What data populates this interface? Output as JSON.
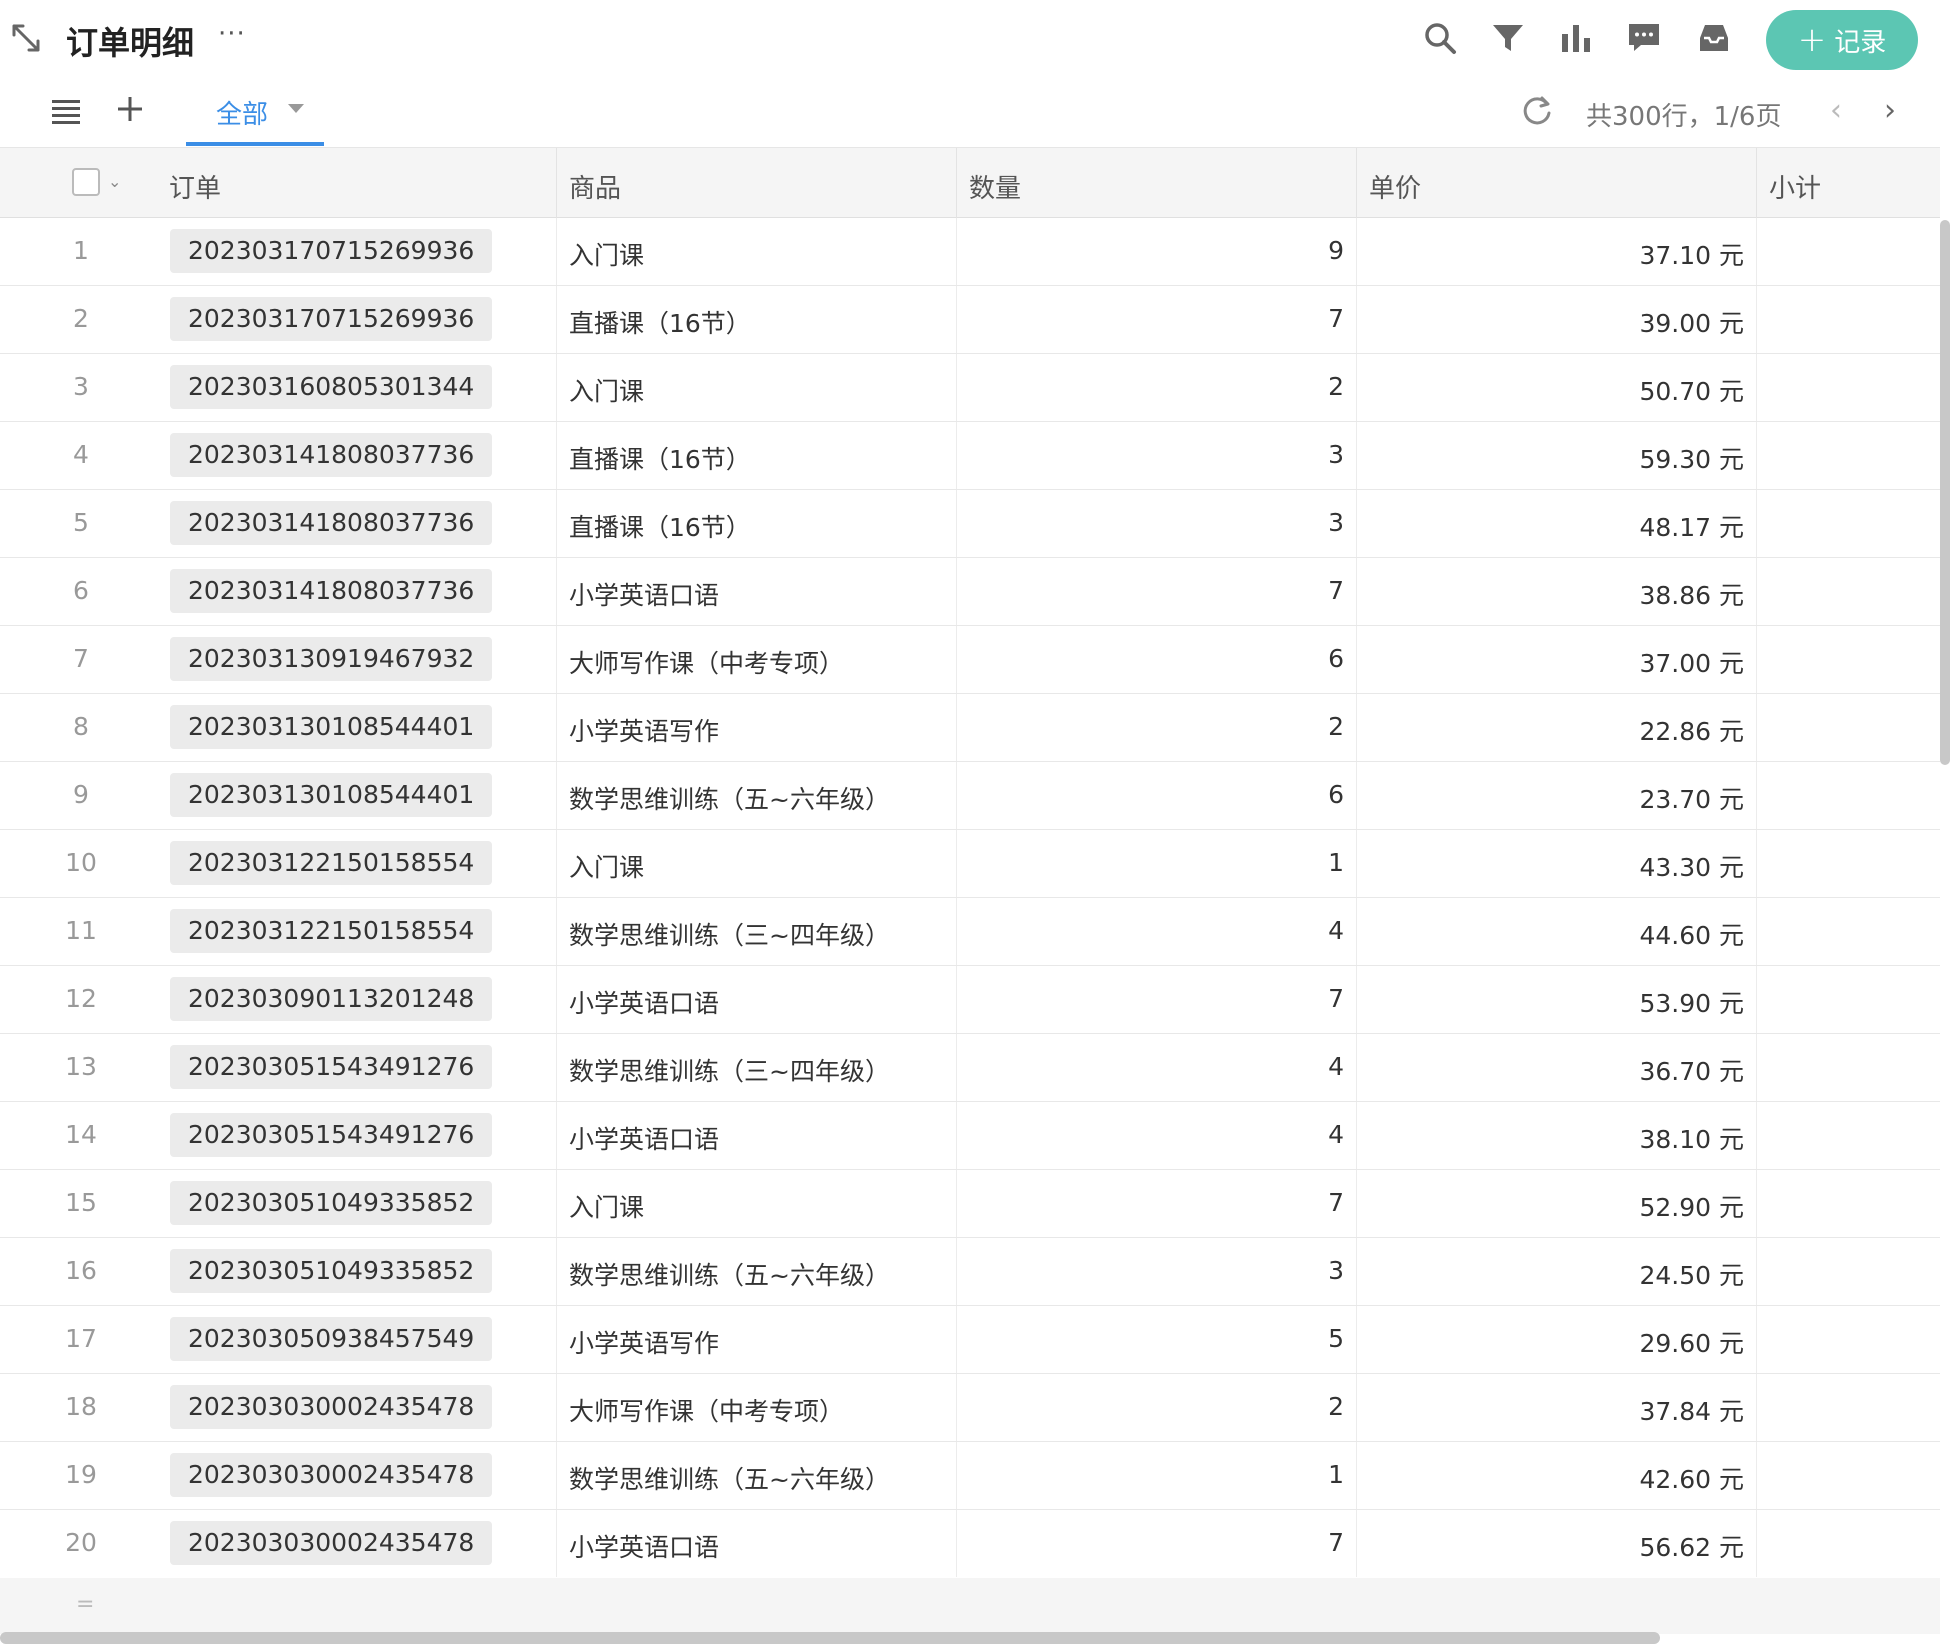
{
  "header": {
    "title": "订单明细",
    "more": "···",
    "add_record_label": "记录",
    "add_record_plus": "+",
    "accent_color": "#5cc6b3"
  },
  "toolbar_icons": [
    "search-icon",
    "filter-icon",
    "bar-chart-icon",
    "comment-icon",
    "inbox-icon"
  ],
  "viewbar": {
    "tab_label": "全部",
    "tab_color": "#3b8ee6",
    "pagination_info": "共300行，1/6页",
    "prev": "‹",
    "next": "›"
  },
  "table": {
    "columns": [
      "订单",
      "商品",
      "数量",
      "单价",
      "小计"
    ],
    "rows": [
      {
        "idx": "1",
        "order": "202303170715269936",
        "goods": "入门课",
        "qty": "9",
        "price": "37.10 元"
      },
      {
        "idx": "2",
        "order": "202303170715269936",
        "goods": "直播课（16节）",
        "qty": "7",
        "price": "39.00 元"
      },
      {
        "idx": "3",
        "order": "202303160805301344",
        "goods": "入门课",
        "qty": "2",
        "price": "50.70 元"
      },
      {
        "idx": "4",
        "order": "202303141808037736",
        "goods": "直播课（16节）",
        "qty": "3",
        "price": "59.30 元"
      },
      {
        "idx": "5",
        "order": "202303141808037736",
        "goods": "直播课（16节）",
        "qty": "3",
        "price": "48.17 元"
      },
      {
        "idx": "6",
        "order": "202303141808037736",
        "goods": "小学英语口语",
        "qty": "7",
        "price": "38.86 元"
      },
      {
        "idx": "7",
        "order": "202303130919467932",
        "goods": "大师写作课（中考专项）",
        "qty": "6",
        "price": "37.00 元"
      },
      {
        "idx": "8",
        "order": "202303130108544401",
        "goods": "小学英语写作",
        "qty": "2",
        "price": "22.86 元"
      },
      {
        "idx": "9",
        "order": "202303130108544401",
        "goods": "数学思维训练（五~六年级）",
        "qty": "6",
        "price": "23.70 元"
      },
      {
        "idx": "10",
        "order": "202303122150158554",
        "goods": "入门课",
        "qty": "1",
        "price": "43.30 元"
      },
      {
        "idx": "11",
        "order": "202303122150158554",
        "goods": "数学思维训练（三~四年级）",
        "qty": "4",
        "price": "44.60 元"
      },
      {
        "idx": "12",
        "order": "202303090113201248",
        "goods": "小学英语口语",
        "qty": "7",
        "price": "53.90 元"
      },
      {
        "idx": "13",
        "order": "202303051543491276",
        "goods": "数学思维训练（三~四年级）",
        "qty": "4",
        "price": "36.70 元"
      },
      {
        "idx": "14",
        "order": "202303051543491276",
        "goods": "小学英语口语",
        "qty": "4",
        "price": "38.10 元"
      },
      {
        "idx": "15",
        "order": "202303051049335852",
        "goods": "入门课",
        "qty": "7",
        "price": "52.90 元"
      },
      {
        "idx": "16",
        "order": "202303051049335852",
        "goods": "数学思维训练（五~六年级）",
        "qty": "3",
        "price": "24.50 元"
      },
      {
        "idx": "17",
        "order": "202303050938457549",
        "goods": "小学英语写作",
        "qty": "5",
        "price": "29.60 元"
      },
      {
        "idx": "18",
        "order": "202303030002435478",
        "goods": "大师写作课（中考专项）",
        "qty": "2",
        "price": "37.84 元"
      },
      {
        "idx": "19",
        "order": "202303030002435478",
        "goods": "数学思维训练（五~六年级）",
        "qty": "1",
        "price": "42.60 元"
      },
      {
        "idx": "20",
        "order": "202303030002435478",
        "goods": "小学英语口语",
        "qty": "7",
        "price": "56.62 元"
      }
    ]
  },
  "footer": {
    "drag_handle": "="
  }
}
